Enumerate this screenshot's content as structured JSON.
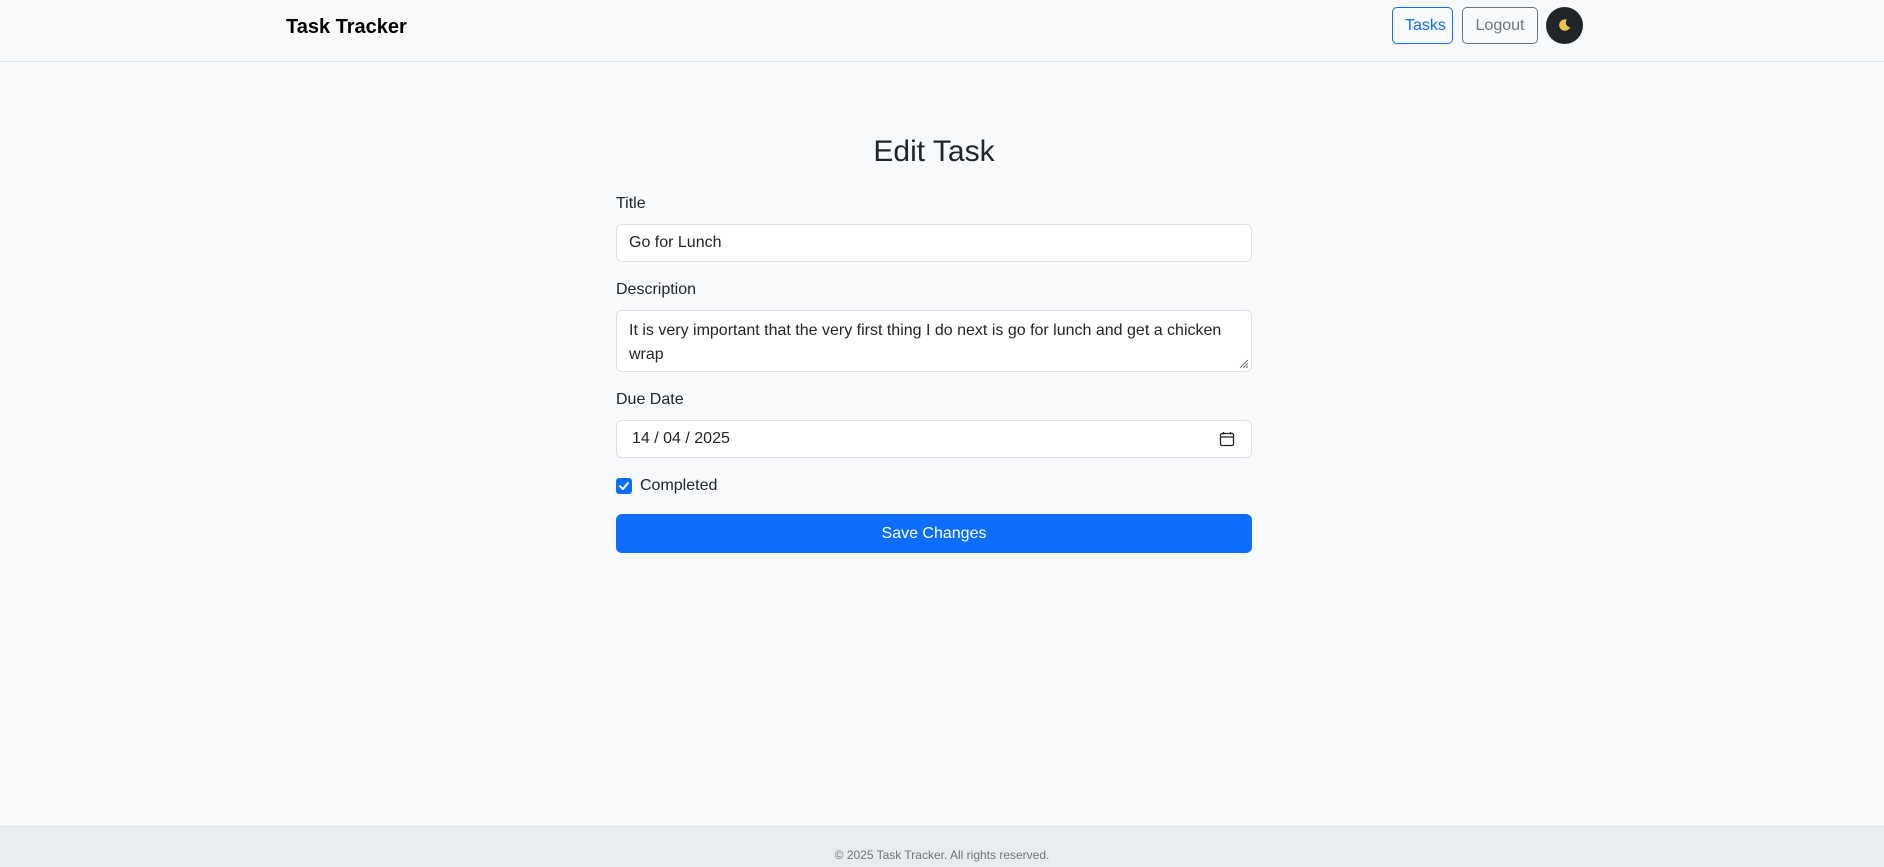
{
  "navbar": {
    "brand": "Task Tracker",
    "tasks_label": "Tasks",
    "logout_label": "Logout",
    "theme_icon": "moon-icon"
  },
  "form": {
    "heading": "Edit Task",
    "title_label": "Title",
    "title_value": "Go for Lunch",
    "description_label": "Description",
    "description_value": "It is very important that the very first thing I do next is go for lunch and get a chicken wrap",
    "due_date_label": "Due Date",
    "due_date_value": "14 / 04 / 2025",
    "completed_label": "Completed",
    "completed_checked": true,
    "save_label": "Save Changes"
  },
  "footer": {
    "text": "© 2025 Task Tracker. All rights reserved."
  },
  "colors": {
    "primary": "#0d6efd",
    "secondary": "#6c757d",
    "dark": "#212529",
    "background": "#f8f9fa",
    "footer_bg": "#e9ecef"
  }
}
